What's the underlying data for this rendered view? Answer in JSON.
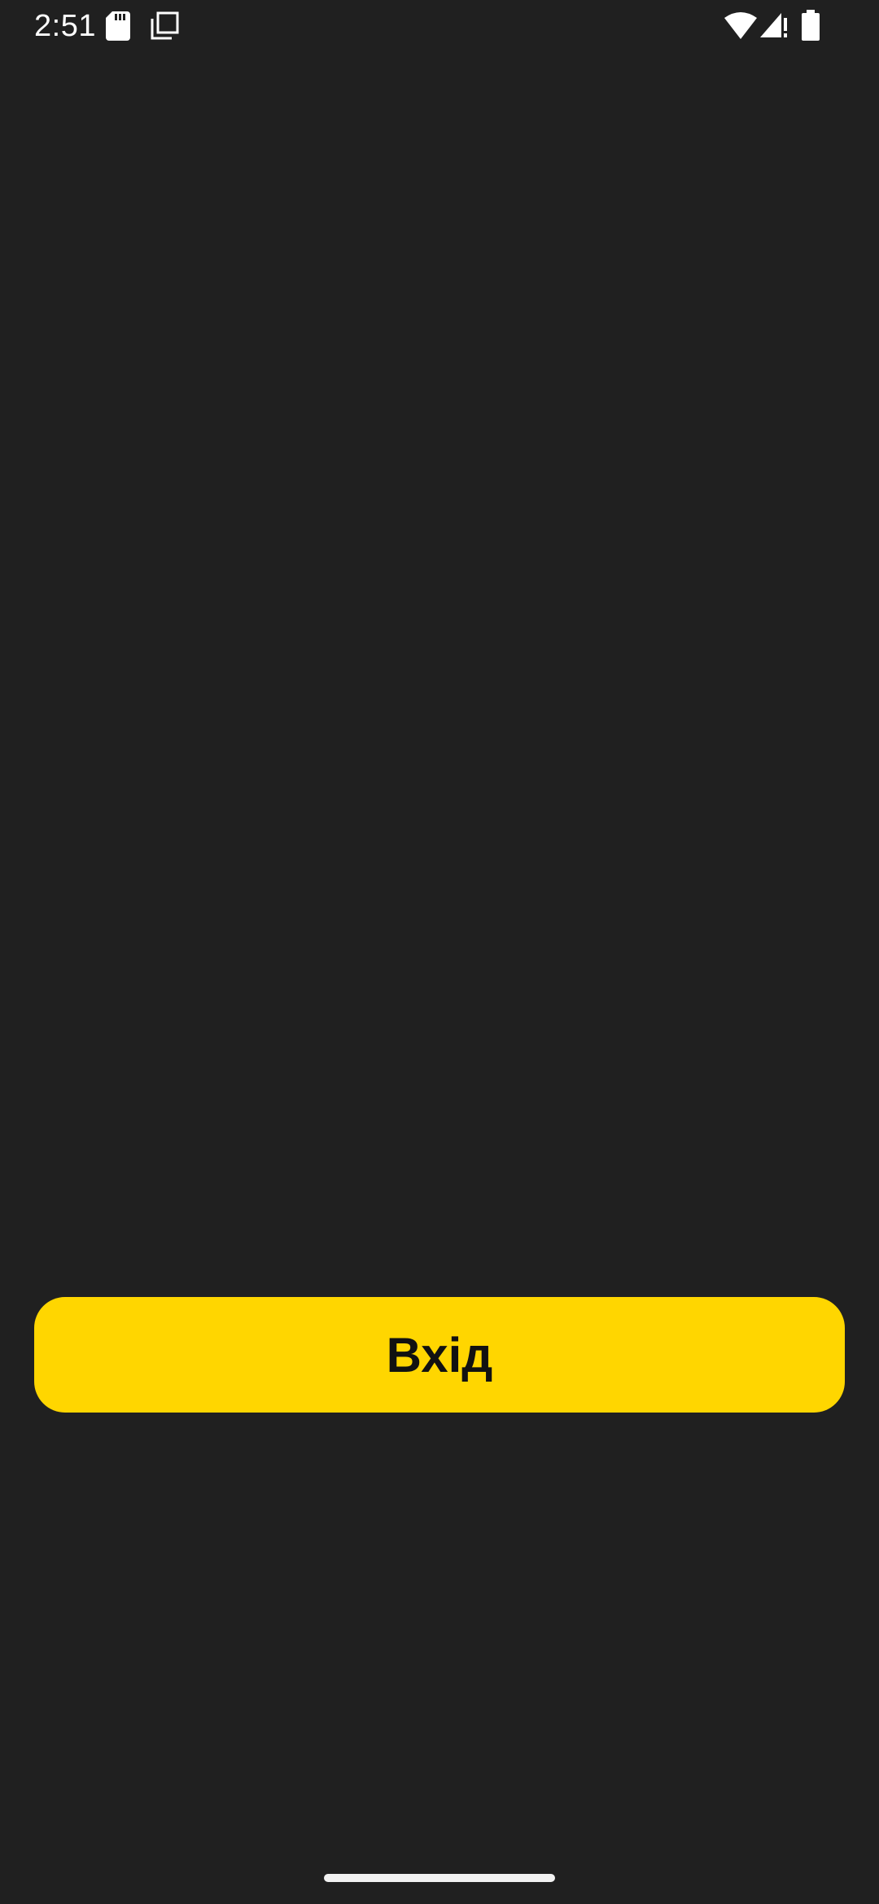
{
  "status_bar": {
    "time": "2:51",
    "icons": [
      "sd-card-icon",
      "copy-icon",
      "wifi-icon",
      "signal-icon",
      "battery-icon"
    ]
  },
  "main": {
    "login_label": "Вхід"
  },
  "colors": {
    "background": "#202020",
    "accent": "#FFD600",
    "button_text": "#111111",
    "status_text": "#FFFFFF"
  }
}
